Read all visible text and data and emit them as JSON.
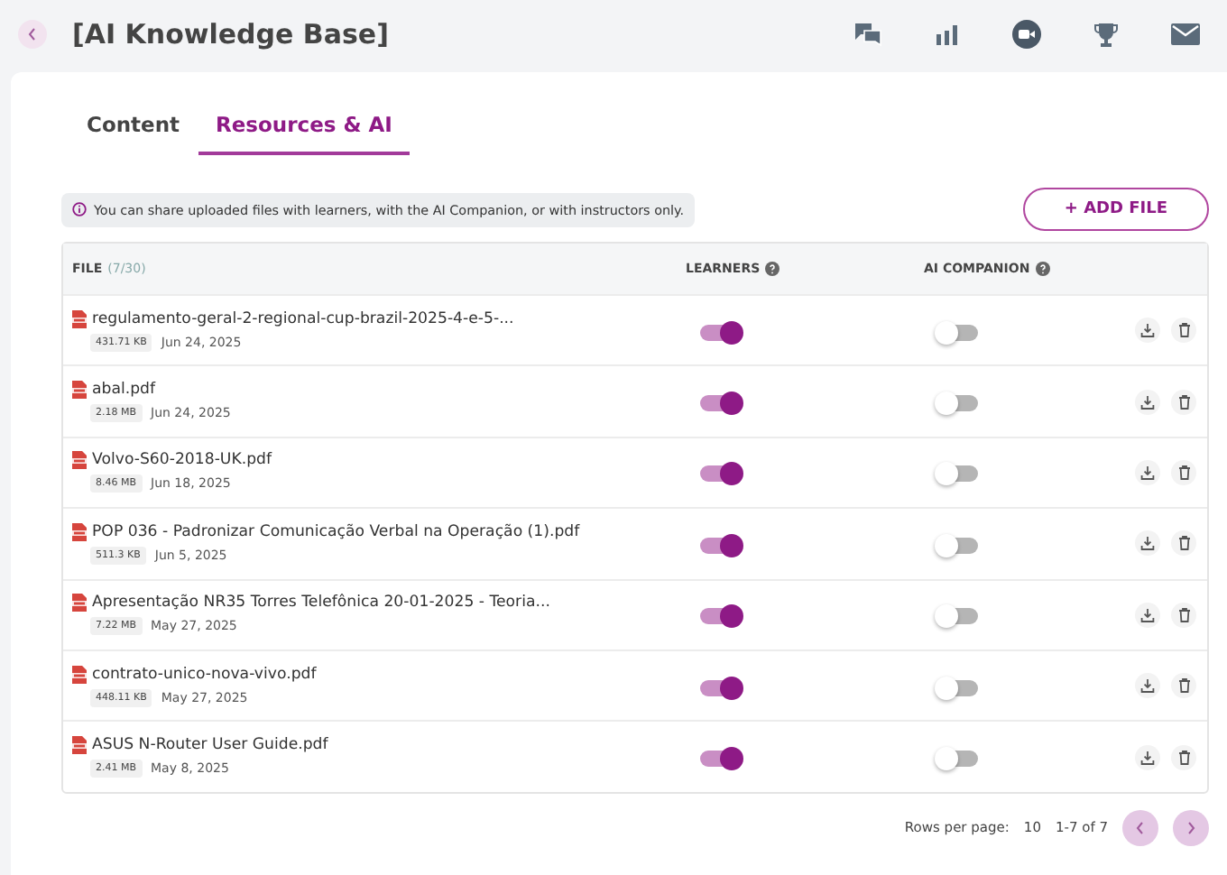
{
  "header": {
    "title": "[AI Knowledge Base]"
  },
  "tabs": [
    {
      "label": "Content",
      "selected": false
    },
    {
      "label": "Resources & AI",
      "selected": true
    }
  ],
  "info_banner": "You can share uploaded files with learners, with the AI Companion, or with instructors only.",
  "add_button": "+ ADD FILE",
  "table": {
    "columns": {
      "file": "FILE",
      "file_count": "(7/30)",
      "learners": "LEARNERS",
      "ai_companion": "AI COMPANION"
    },
    "rows": [
      {
        "name": "regulamento-geral-2-regional-cup-brazil-2025-4-e-5-...",
        "size": "431.71 KB",
        "date": "Jun 24, 2025",
        "learners": true,
        "ai_companion": false
      },
      {
        "name": "abal.pdf",
        "size": "2.18 MB",
        "date": "Jun 24, 2025",
        "learners": true,
        "ai_companion": false
      },
      {
        "name": "Volvo-S60-2018-UK.pdf",
        "size": "8.46 MB",
        "date": "Jun 18, 2025",
        "learners": true,
        "ai_companion": false
      },
      {
        "name": "POP 036 - Padronizar Comunicação Verbal na Operação (1).pdf",
        "size": "511.3 KB",
        "date": "Jun 5, 2025",
        "learners": true,
        "ai_companion": false
      },
      {
        "name": "Apresentação NR35 Torres Telefônica 20-01-2025 - Teoria...",
        "size": "7.22 MB",
        "date": "May 27, 2025",
        "learners": true,
        "ai_companion": false
      },
      {
        "name": "contrato-unico-nova-vivo.pdf",
        "size": "448.11 KB",
        "date": "May 27, 2025",
        "learners": true,
        "ai_companion": false
      },
      {
        "name": "ASUS N-Router User Guide.pdf",
        "size": "2.41 MB",
        "date": "May 8, 2025",
        "learners": true,
        "ai_companion": false
      }
    ]
  },
  "pagination": {
    "rows_per_page_label": "Rows per page:",
    "rows_per_page": "10",
    "range": "1-7 of 7"
  }
}
